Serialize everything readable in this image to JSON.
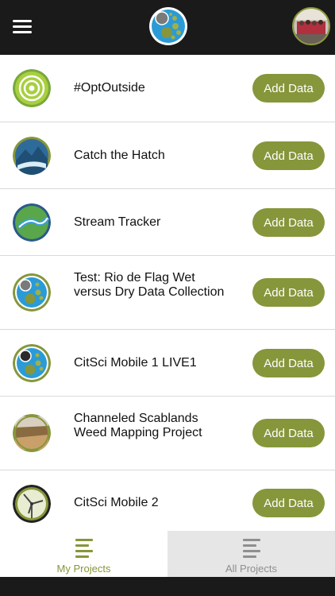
{
  "header": {
    "menu_icon": "hamburger-menu-icon",
    "logo_icon": "citsci-logo-icon",
    "avatar_icon": "user-avatar-icon"
  },
  "projects": [
    {
      "title": "#OptOutside",
      "button": "Add Data",
      "icon": "green-spiral-icon"
    },
    {
      "title": "Catch the Hatch",
      "button": "Add Data",
      "icon": "mountain-river-icon"
    },
    {
      "title": "Stream Tracker",
      "button": "Add Data",
      "icon": "stream-icon"
    },
    {
      "title": "Test: Rio de Flag Wet versus Dry Data Collection",
      "button": "Add Data",
      "icon": "citsci-circles-icon"
    },
    {
      "title": "CitSci Mobile 1 LIVE1",
      "button": "Add Data",
      "icon": "citsci-circles-icon"
    },
    {
      "title": "Channeled Scablands Weed Mapping Project",
      "button": "Add Data",
      "icon": "landscape-photo-icon"
    },
    {
      "title": "CitSci Mobile 2",
      "button": "Add Data",
      "icon": "windmill-icon"
    }
  ],
  "tabs": [
    {
      "label": "My Projects",
      "active": true
    },
    {
      "label": "All Projects",
      "active": false
    }
  ],
  "colors": {
    "accent": "#86963b",
    "topbar": "#1a1a1a",
    "divider": "#d9d9d9"
  }
}
